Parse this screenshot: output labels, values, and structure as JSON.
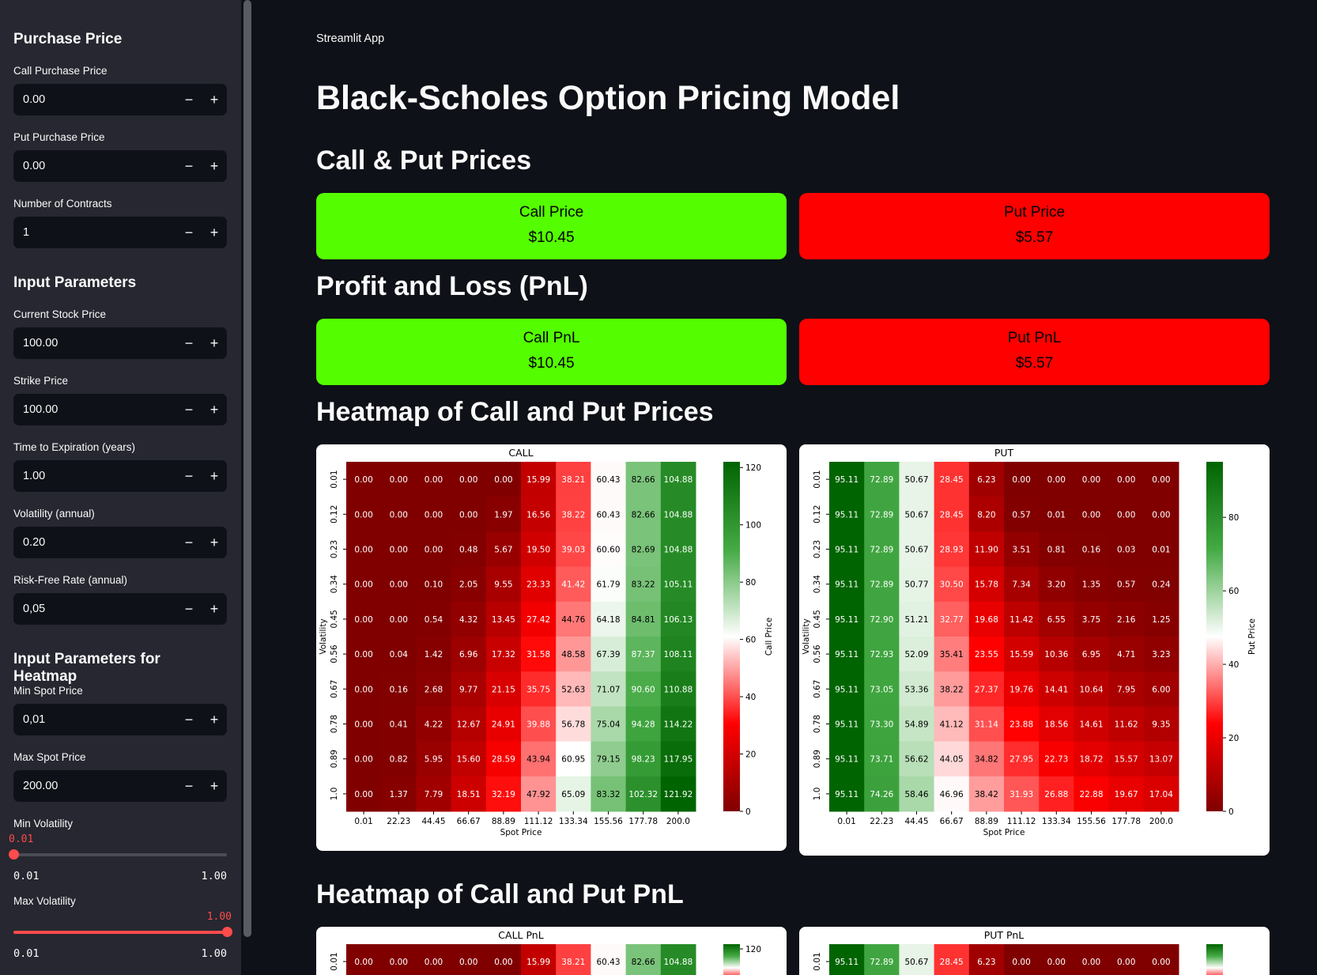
{
  "sidebar": {
    "purchase_heading": "Purchase Price",
    "call_purchase": {
      "label": "Call Purchase Price",
      "value": "0.00"
    },
    "put_purchase": {
      "label": "Put Purchase Price",
      "value": "0.00"
    },
    "contracts": {
      "label": "Number of Contracts",
      "value": "1"
    },
    "input_heading": "Input Parameters",
    "stock_price": {
      "label": "Current Stock Price",
      "value": "100.00"
    },
    "strike_price": {
      "label": "Strike Price",
      "value": "100.00"
    },
    "time_exp": {
      "label": "Time to Expiration (years)",
      "value": "1.00"
    },
    "volatility": {
      "label": "Volatility (annual)",
      "value": "0.20"
    },
    "risk_free": {
      "label": "Risk-Free Rate (annual)",
      "value": "0,05"
    },
    "heatmap_heading": "Input Parameters for Heatmap",
    "min_spot": {
      "label": "Min Spot Price",
      "value": "0,01"
    },
    "max_spot": {
      "label": "Max Spot Price",
      "value": "200.00"
    },
    "min_vol": {
      "label": "Min Volatility",
      "current": "0.01",
      "min": "0.01",
      "max": "1.00",
      "fraction": 0.0
    },
    "max_vol": {
      "label": "Max Volatility",
      "current": "1.00",
      "min": "0.01",
      "max": "1.00",
      "fraction": 1.0
    },
    "minus": "−",
    "plus": "+"
  },
  "main": {
    "app_label": "Streamlit App",
    "title": "Black-Scholes Option Pricing Model",
    "prices_heading": "Call & Put Prices",
    "call_price": {
      "label": "Call Price",
      "value": "$10.45"
    },
    "put_price": {
      "label": "Put Price",
      "value": "$5.57"
    },
    "pnl_heading": "Profit and Loss (PnL)",
    "call_pnl": {
      "label": "Call PnL",
      "value": "$10.45"
    },
    "put_pnl": {
      "label": "Put PnL",
      "value": "$5.57"
    },
    "heatmap_prices_heading": "Heatmap of Call and Put Prices",
    "heatmap_pnl_heading": "Heatmap of Call and Put PnL"
  },
  "colors": {
    "accent": "#ff4b4b",
    "green_metric": "#54fe00",
    "red_metric": "#fe0000",
    "sidebar_bg": "#262730",
    "main_bg": "#0e1117"
  },
  "chart_data": [
    {
      "type": "heatmap",
      "title": "CALL",
      "xlabel": "Spot Price",
      "ylabel": "Volatility",
      "colorbar_label": "Call Price",
      "x": [
        "0.01",
        "22.23",
        "44.45",
        "66.67",
        "88.89",
        "111.12",
        "133.34",
        "155.56",
        "177.78",
        "200.0"
      ],
      "y": [
        "0.01",
        "0.12",
        "0.23",
        "0.34",
        "0.45",
        "0.56",
        "0.67",
        "0.78",
        "0.89",
        "1.0"
      ],
      "cbar_ticks": [
        0,
        20,
        40,
        60,
        80,
        100,
        120
      ],
      "vmin": 0,
      "vmax": 122,
      "values": [
        [
          0.0,
          0.0,
          0.0,
          0.0,
          0.0,
          15.99,
          38.21,
          60.43,
          82.66,
          104.88
        ],
        [
          0.0,
          0.0,
          0.0,
          0.0,
          1.97,
          16.56,
          38.22,
          60.43,
          82.66,
          104.88
        ],
        [
          0.0,
          0.0,
          0.0,
          0.48,
          5.67,
          19.5,
          39.03,
          60.6,
          82.69,
          104.88
        ],
        [
          0.0,
          0.0,
          0.1,
          2.05,
          9.55,
          23.33,
          41.42,
          61.79,
          83.22,
          105.11
        ],
        [
          0.0,
          0.0,
          0.54,
          4.32,
          13.45,
          27.42,
          44.76,
          64.18,
          84.81,
          106.13
        ],
        [
          0.0,
          0.04,
          1.42,
          6.96,
          17.32,
          31.58,
          48.58,
          67.39,
          87.37,
          108.11
        ],
        [
          0.0,
          0.16,
          2.68,
          9.77,
          21.15,
          35.75,
          52.63,
          71.07,
          90.6,
          110.88
        ],
        [
          0.0,
          0.41,
          4.22,
          12.67,
          24.91,
          39.88,
          56.78,
          75.04,
          94.28,
          114.22
        ],
        [
          0.0,
          0.82,
          5.95,
          15.6,
          28.59,
          43.94,
          60.95,
          79.15,
          98.23,
          117.95
        ],
        [
          0.0,
          1.37,
          7.79,
          18.51,
          32.19,
          47.92,
          65.09,
          83.32,
          102.32,
          121.92
        ]
      ]
    },
    {
      "type": "heatmap",
      "title": "PUT",
      "xlabel": "Spot Price",
      "ylabel": "Volatility",
      "colorbar_label": "Put Price",
      "x": [
        "0.01",
        "22.23",
        "44.45",
        "66.67",
        "88.89",
        "111.12",
        "133.34",
        "155.56",
        "177.78",
        "200.0"
      ],
      "y": [
        "0.01",
        "0.12",
        "0.23",
        "0.34",
        "0.45",
        "0.56",
        "0.67",
        "0.78",
        "0.89",
        "1.0"
      ],
      "cbar_ticks": [
        0,
        20,
        40,
        60,
        80
      ],
      "vmin": 0,
      "vmax": 95.11,
      "values": [
        [
          95.11,
          72.89,
          50.67,
          28.45,
          6.23,
          0.0,
          0.0,
          0.0,
          0.0,
          0.0
        ],
        [
          95.11,
          72.89,
          50.67,
          28.45,
          8.2,
          0.57,
          0.01,
          0.0,
          0.0,
          0.0
        ],
        [
          95.11,
          72.89,
          50.67,
          28.93,
          11.9,
          3.51,
          0.81,
          0.16,
          0.03,
          0.01
        ],
        [
          95.11,
          72.89,
          50.77,
          30.5,
          15.78,
          7.34,
          3.2,
          1.35,
          0.57,
          0.24
        ],
        [
          95.11,
          72.9,
          51.21,
          32.77,
          19.68,
          11.42,
          6.55,
          3.75,
          2.16,
          1.25
        ],
        [
          95.11,
          72.93,
          52.09,
          35.41,
          23.55,
          15.59,
          10.36,
          6.95,
          4.71,
          3.23
        ],
        [
          95.11,
          73.05,
          53.36,
          38.22,
          27.37,
          19.76,
          14.41,
          10.64,
          7.95,
          6.0
        ],
        [
          95.11,
          73.3,
          54.89,
          41.12,
          31.14,
          23.88,
          18.56,
          14.61,
          11.62,
          9.35
        ],
        [
          95.11,
          73.71,
          56.62,
          44.05,
          34.82,
          27.95,
          22.73,
          18.72,
          15.57,
          13.07
        ],
        [
          95.11,
          74.26,
          58.46,
          46.96,
          38.42,
          31.93,
          26.88,
          22.88,
          19.67,
          17.04
        ]
      ]
    },
    {
      "type": "heatmap",
      "title": "CALL PnL",
      "y": [
        "0.01"
      ],
      "x": [],
      "cbar_ticks": [
        120
      ],
      "vmin": 0,
      "vmax": 122,
      "values": [
        [
          0.0,
          0.0,
          0.0,
          0.0,
          0.0,
          15.99,
          38.21,
          60.43,
          82.66,
          104.88
        ]
      ]
    },
    {
      "type": "heatmap",
      "title": "PUT PnL",
      "y": [
        "0.01"
      ],
      "x": [],
      "cbar_ticks": [],
      "vmin": 0,
      "vmax": 95.11,
      "values": [
        [
          95.11,
          72.89,
          50.67,
          28.45,
          6.23,
          0.0,
          0.0,
          0.0,
          0.0,
          0.0
        ]
      ]
    }
  ]
}
